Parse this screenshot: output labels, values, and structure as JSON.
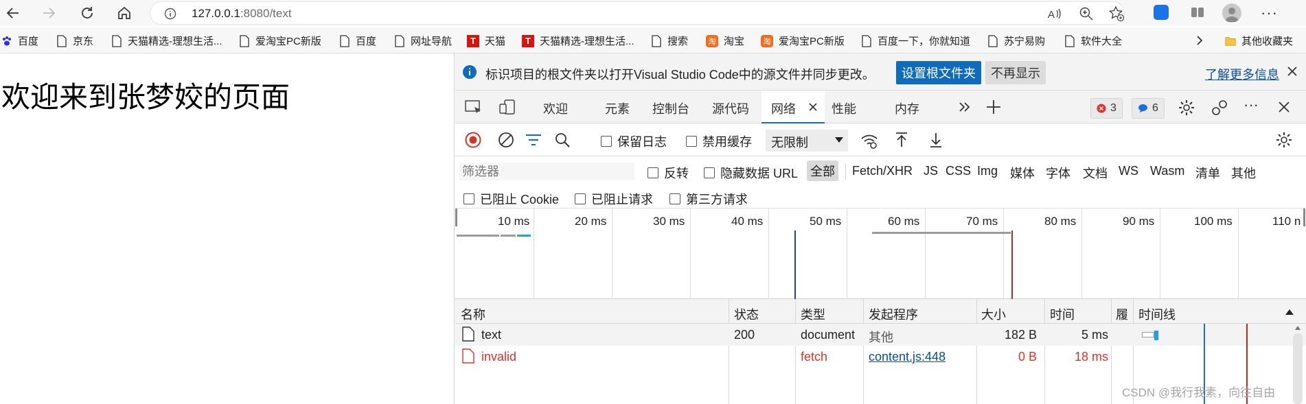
{
  "browser": {
    "url_host": "127.0.0.1",
    "url_rest": ":8080/text"
  },
  "bookmarks": [
    {
      "label": "百度",
      "icon": "paw-icon"
    },
    {
      "label": "京东",
      "icon": "page-icon"
    },
    {
      "label": "天猫精选-理想生活...",
      "icon": "page-icon"
    },
    {
      "label": "爱淘宝PC新版",
      "icon": "page-icon"
    },
    {
      "label": "百度",
      "icon": "page-icon"
    },
    {
      "label": "网址导航",
      "icon": "page-icon"
    },
    {
      "label": "天猫",
      "icon": "tmall-icon"
    },
    {
      "label": "天猫精选-理想生活...",
      "icon": "tmall-icon"
    },
    {
      "label": "搜索",
      "icon": "page-icon"
    },
    {
      "label": "淘宝",
      "icon": "taobao-icon"
    },
    {
      "label": "爱淘宝PC新版",
      "icon": "taobao-icon"
    },
    {
      "label": "百度一下，你就知道",
      "icon": "page-icon"
    },
    {
      "label": "苏宁易购",
      "icon": "page-icon"
    },
    {
      "label": "软件大全",
      "icon": "page-icon"
    }
  ],
  "bookmarks_other": "其他收藏夹",
  "tmall_glyph": "T",
  "taobao_glyph": "淘",
  "page": {
    "heading": "欢迎来到张梦姣的页面"
  },
  "devtools": {
    "infobar": {
      "message": "标识项目的根文件夹以打开Visual Studio Code中的源文件并同步更改。",
      "set_root": "设置根文件夹",
      "dismiss": "不再显示",
      "learn_more": "了解更多信息"
    },
    "tabs": [
      "欢迎",
      "元素",
      "控制台",
      "源代码",
      "网络",
      "性能",
      "内存"
    ],
    "active_tab": "网络",
    "error_count": "3",
    "message_count": "6",
    "toolbar": {
      "preserve_log": "保留日志",
      "disable_cache": "禁用缓存",
      "throttle": "无限制"
    },
    "filter": {
      "placeholder": "筛选器",
      "invert": "反转",
      "hide_data_urls": "隐藏数据 URL",
      "types": [
        "全部",
        "Fetch/XHR",
        "JS",
        "CSS",
        "Img",
        "媒体",
        "字体",
        "文档",
        "WS",
        "Wasm",
        "清单",
        "其他"
      ],
      "blocked_cookies": "已阻止 Cookie",
      "blocked_requests": "已阻止请求",
      "third_party": "第三方请求"
    },
    "timeline_ticks": [
      "10 ms",
      "20 ms",
      "30 ms",
      "40 ms",
      "50 ms",
      "60 ms",
      "70 ms",
      "80 ms",
      "90 ms",
      "100 ms",
      "110 n"
    ],
    "table": {
      "headers": [
        "名称",
        "状态",
        "类型",
        "发起程序",
        "大小",
        "时间",
        "履",
        "时间线"
      ],
      "rows": [
        {
          "name": "text",
          "status": "200",
          "type": "document",
          "initiator": "其他",
          "size": "182 B",
          "time": "5 ms",
          "error": false
        },
        {
          "name": "invalid",
          "status": "",
          "type": "fetch",
          "initiator": "content.js:448",
          "size": "0 B",
          "time": "18 ms",
          "error": true
        }
      ]
    }
  },
  "watermark": "CSDN @我行我素，向往自由",
  "colors": {
    "accent": "#0f6cbd",
    "error": "#e0342a",
    "record": "#d93025"
  }
}
